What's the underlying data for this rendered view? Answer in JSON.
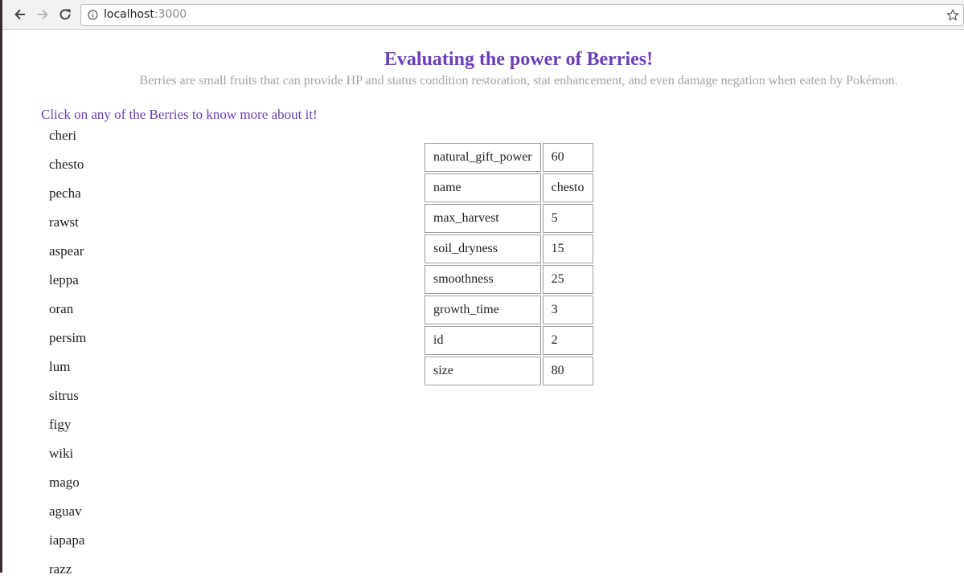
{
  "browser": {
    "url_host": "localhost",
    "url_port": ":3000"
  },
  "page": {
    "title": "Evaluating the power of Berries!",
    "subtitle": "Berries are small fruits that can provide HP and status condition restoration, stat enhancement, and even damage negation when eaten by Pokémon.",
    "instruction": "Click on any of the Berries to know more about it!"
  },
  "berries": [
    "cheri",
    "chesto",
    "pecha",
    "rawst",
    "aspear",
    "leppa",
    "oran",
    "persim",
    "lum",
    "sitrus",
    "figy",
    "wiki",
    "mago",
    "aguav",
    "iapapa",
    "razz"
  ],
  "details": [
    {
      "key": "natural_gift_power",
      "value": "60"
    },
    {
      "key": "name",
      "value": "chesto"
    },
    {
      "key": "max_harvest",
      "value": "5"
    },
    {
      "key": "soil_dryness",
      "value": "15"
    },
    {
      "key": "smoothness",
      "value": "25"
    },
    {
      "key": "growth_time",
      "value": "3"
    },
    {
      "key": "id",
      "value": "2"
    },
    {
      "key": "size",
      "value": "80"
    }
  ],
  "colors": {
    "accent": "#6a3fb8",
    "subtitle": "#a3a3a3"
  }
}
